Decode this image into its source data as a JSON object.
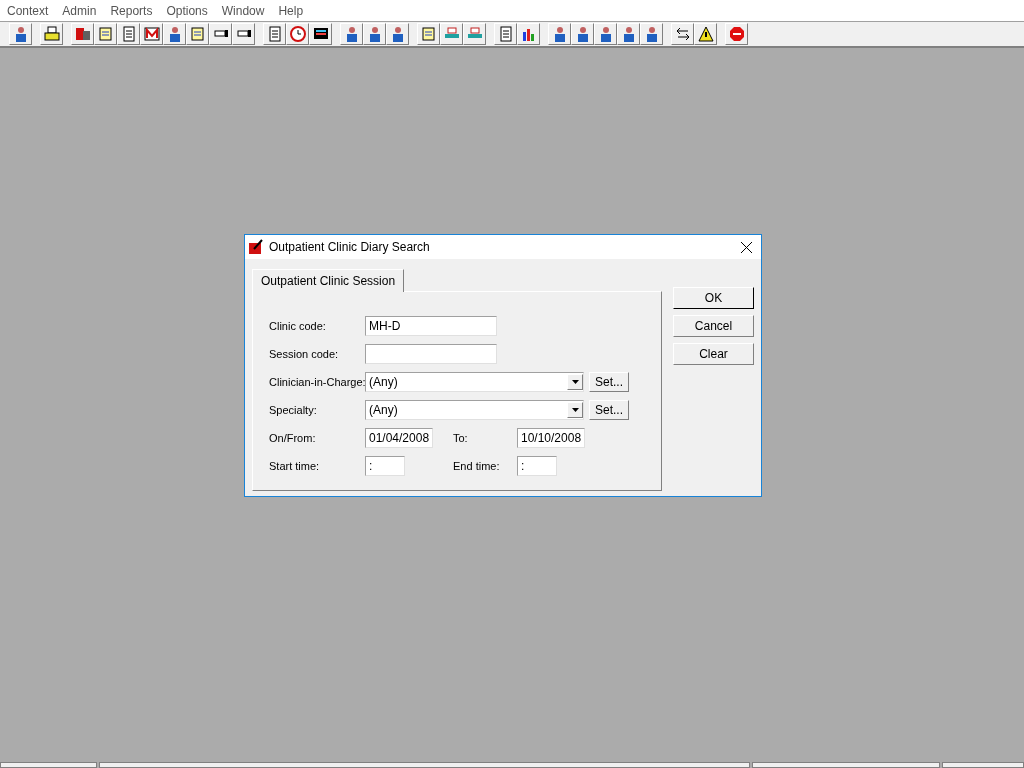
{
  "menu": [
    "Context",
    "Admin",
    "Reports",
    "Options",
    "Window",
    "Help"
  ],
  "dialog": {
    "title": "Outpatient Clinic Diary Search",
    "tabs": [
      {
        "label": "Outpatient Clinic Session",
        "selected": true
      }
    ],
    "rows": [
      {
        "kind": "text",
        "label": "Clinic code:",
        "value": "MH-D"
      },
      {
        "kind": "text",
        "label": "Session code:"
      },
      {
        "kind": "combo",
        "label": "Clinician-in-Charge:",
        "value": "(Any)",
        "button": "Set..."
      },
      {
        "kind": "combo",
        "label": "Specialty:",
        "value": "(Any)",
        "button": "Set..."
      },
      {
        "kind": "date_pair",
        "label": "On/From:",
        "value": "01/04/2008",
        "label2": "To:",
        "value2": "10/10/2008"
      },
      {
        "kind": "time_pair",
        "label": "Start time:",
        "value": ":",
        "label2": "End time:",
        "value2": ":"
      }
    ],
    "buttons": [
      "OK",
      "Cancel",
      "Clear"
    ]
  }
}
